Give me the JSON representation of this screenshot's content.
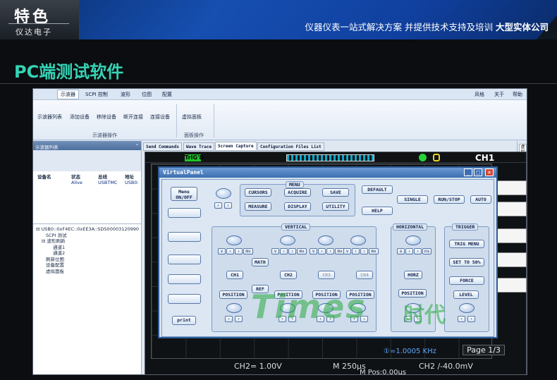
{
  "banner": {
    "badge_title": "特色",
    "badge_subtitle": "仪达电子",
    "tagline_a": "仪器仪表一站式解决方案  并提供技术支持及培训 ",
    "tagline_b": "大型实体公司"
  },
  "section_title": "PC端测试软件",
  "app": {
    "menu": {
      "tab_active": "示波器",
      "tab_scpi": "SCPI 控制",
      "tab_wave": "波形",
      "tab_pos": "位图",
      "tab_cfg": "配置",
      "right1": "风格",
      "right2": "关于",
      "right3": "帮助"
    },
    "ribbon": {
      "b1": "示波器列表",
      "b2": "添加设备",
      "b3": "移除设备",
      "b4": "断开连接",
      "b5": "连接设备",
      "b6": "虚拟面板",
      "grp1": "示波器操作",
      "grp2": "面板操作"
    },
    "left": {
      "title": "示波器列表",
      "pin": "ᵖ",
      "h1": "设备名",
      "h2": "状态",
      "h3": "总线",
      "h4": "地址",
      "r_status": "Alive",
      "r_bus": "USBTMC",
      "r_addr": "USB0:",
      "tree": [
        "USB0::0xF4EC::0xEE3A::SDS00003120990",
        "SCPI 测试",
        "波形刷新",
        "通道1",
        "通道2",
        "刷新位图",
        "设备配置",
        "虚拟面板"
      ]
    },
    "tabs": [
      "Send Commands",
      "Wave Trace",
      "Screen Capture",
      "Configuration Files List"
    ],
    "rightstrip": "虚拟面板",
    "scope": {
      "green": "TrIG'D",
      "ch": "CH1",
      "ch2": "CH2= 1.00V",
      "time": "M 250μs",
      "ch2trig": "CH2 ∕-40.0mV",
      "mpos": "M Pos:0.00μs",
      "page": "Page 1/3",
      "freq": "①=1.0005 KHz"
    }
  },
  "virtualpanel": {
    "title": "VirtualPanel",
    "menu_onoff": "Menu ON/OFF",
    "menu_title": "MENU",
    "cursors": "CURSORS",
    "acquire": "ACQUIRE",
    "save": "SAVE",
    "measure": "MEASURE",
    "display": "DISPLAY",
    "utility": "UTILITY",
    "default": "DEFAULT",
    "help": "HELP",
    "single": "SINGLE",
    "runstop": "RUN/STOP",
    "auto": "AUTO",
    "vertical": "VERTICAL",
    "horizontal": "HORIZONTAL",
    "trigger": "TRIGGER",
    "math": "MATH",
    "ref": "REF",
    "ch1": "CH1",
    "ch2": "CH2",
    "ch3": "CH3",
    "ch4": "CH4",
    "position": "POSITION",
    "horz": "HORZ",
    "trig_menu": "TRIG MENU",
    "set50": "SET TO 50%",
    "force": "FORCE",
    "level": "LEVEL",
    "print": "print",
    "mv": "mv",
    "ns": "ns",
    "s": "s"
  },
  "watermark": {
    "a": "Times",
    "b": "时代"
  }
}
